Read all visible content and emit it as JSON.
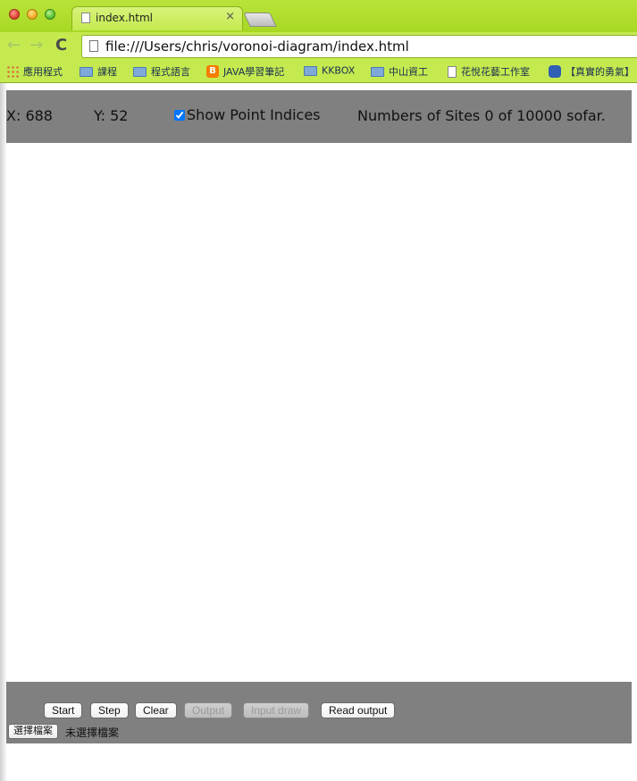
{
  "browser": {
    "tab_title": "index.html",
    "tab_close": "×",
    "url": "file:///Users/chris/voronoi-diagram/index.html",
    "back": "←",
    "forward": "→",
    "reload": "C"
  },
  "bookmarks": [
    {
      "label": "應用程式",
      "icon": "apps-icon"
    },
    {
      "label": "課程",
      "icon": "folder-icon"
    },
    {
      "label": "程式語言",
      "icon": "folder-icon"
    },
    {
      "label": "JAVA學習筆記",
      "icon": "blogger-icon"
    },
    {
      "label": "KKBOX",
      "icon": "folder-icon"
    },
    {
      "label": "中山資工",
      "icon": "folder-icon"
    },
    {
      "label": "花悅花藝工作室",
      "icon": "page-icon"
    },
    {
      "label": "【真實的勇氣】",
      "icon": "bubble-icon"
    }
  ],
  "blogger_glyph": "B",
  "info": {
    "x_text": "X: 688",
    "y_text": "Y: 52",
    "show_indices_label": "Show Point Indices",
    "show_indices_checked": true,
    "sites_text": "Numbers of Sites 0 of 10000 sofar."
  },
  "controls": {
    "start": "Start",
    "step": "Step",
    "clear": "Clear",
    "output": "Output",
    "input_draw": "Input draw",
    "read_output": "Read output",
    "choose_file": "選擇檔案",
    "no_file": "未選擇檔案"
  }
}
